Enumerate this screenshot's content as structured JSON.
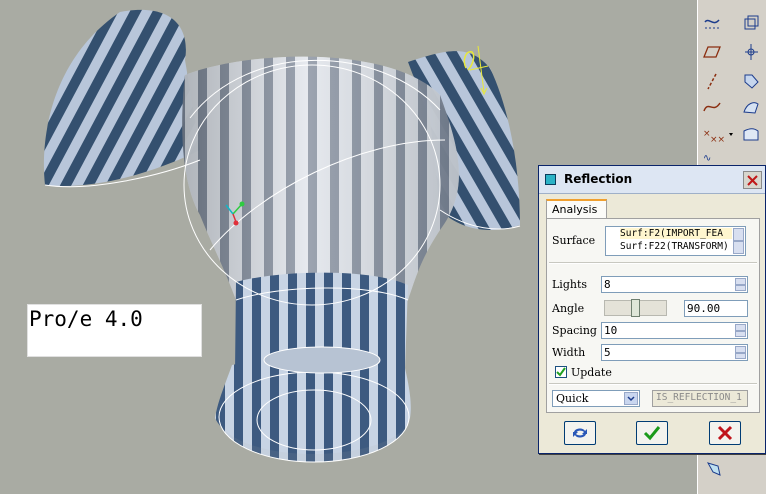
{
  "viewport": {
    "watermark": "Pro/e 4.0",
    "model_icon": "zebra-stripe-surface-model",
    "annotation_icon": "yellow-dimension-annotation"
  },
  "toolbar": {
    "buttons": [
      {
        "icon": "datum-curve-sketch-icon"
      },
      {
        "icon": "offset-surface-icon"
      },
      {
        "icon": "datum-plane-icon"
      },
      {
        "icon": "datum-point-icon"
      },
      {
        "icon": "datum-axis-icon"
      },
      {
        "icon": "extend-surface-icon"
      },
      {
        "icon": "spline-curve-icon"
      },
      {
        "icon": "style-surface-icon"
      },
      {
        "icon": "datum-points-dropdown-icon"
      },
      {
        "icon": "boundary-blend-icon"
      },
      {
        "icon": "curve-analysis-icon"
      },
      {
        "icon": "reflection-analysis-icon"
      }
    ]
  },
  "dialog": {
    "title": "Reflection",
    "tab_label": "Analysis",
    "surface_label": "Surface",
    "surfaces": [
      "Surf:F2(IMPORT_FEA",
      "Surf:F22(TRANSFORM)"
    ],
    "lights_label": "Lights",
    "lights_value": "8",
    "angle_label": "Angle",
    "angle_value": "90.00",
    "angle_slider_fraction": 0.5,
    "spacing_label": "Spacing",
    "spacing_value": "10",
    "width_label": "Width",
    "width_value": "5",
    "update_label": "Update",
    "update_checked": true,
    "mode_value": "Quick",
    "result_name": "IS_REFLECTION_1",
    "colors": {
      "ok_check": "#1a9a1a",
      "cancel_x": "#c0141c",
      "tab_accent": "#f0a030"
    }
  }
}
